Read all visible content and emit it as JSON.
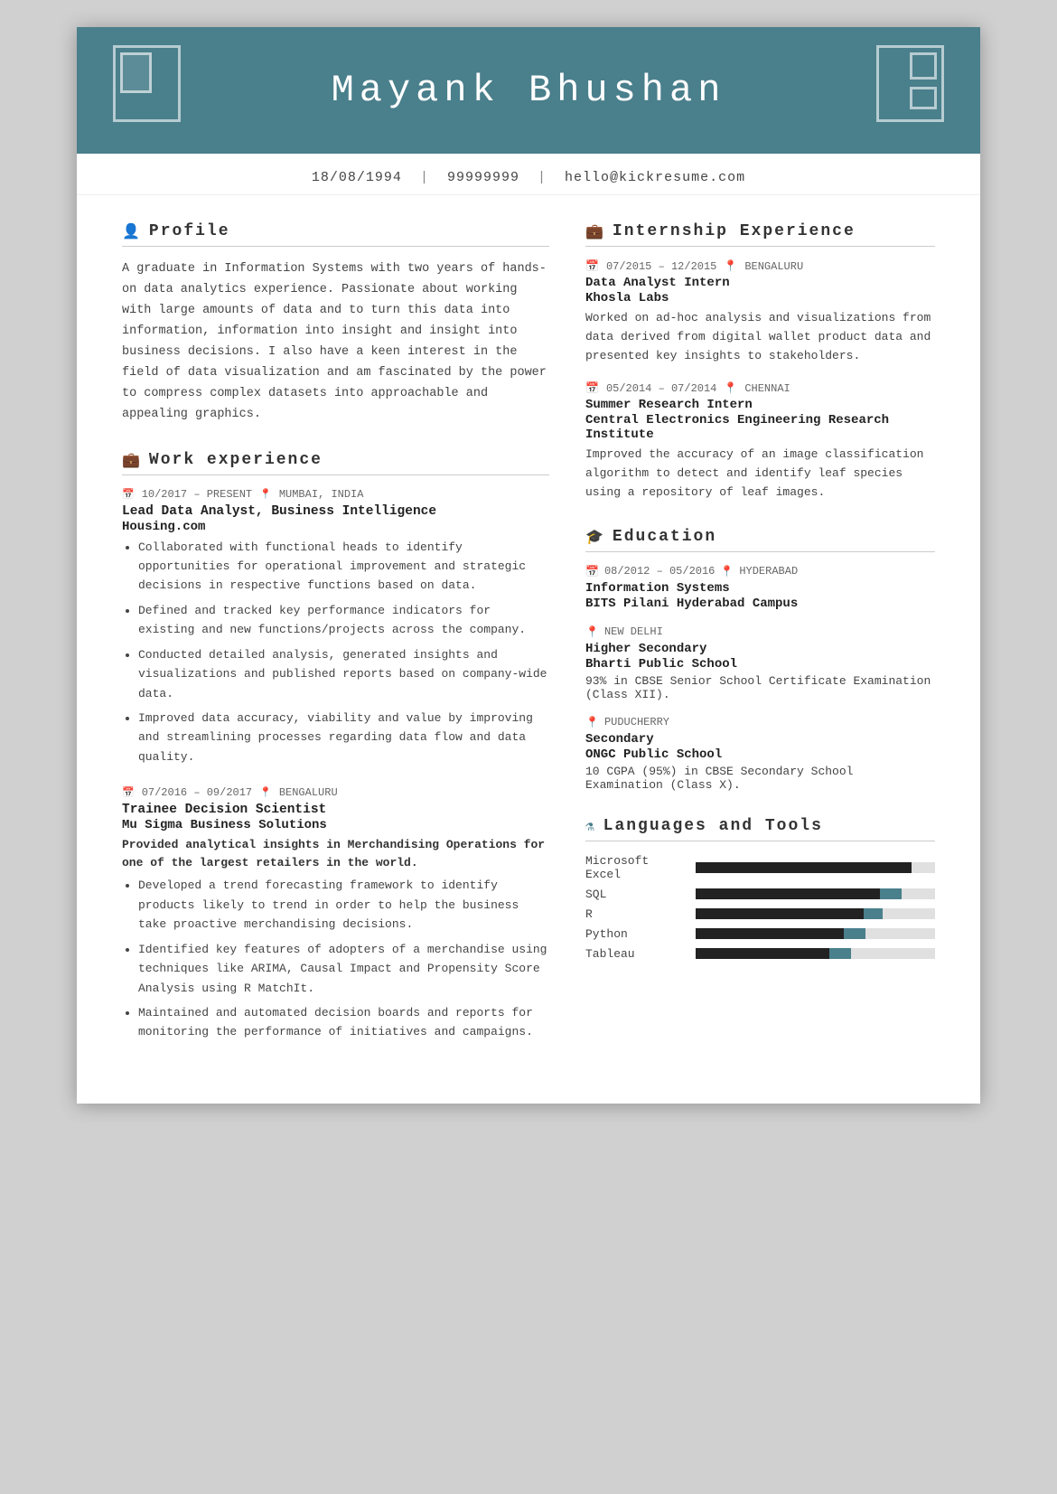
{
  "header": {
    "name": "Mayank  Bhushan"
  },
  "contact": {
    "dob": "18/08/1994",
    "phone": "99999999",
    "email": "hello@kickresume.com"
  },
  "profile": {
    "section_label": "Profile",
    "text": "A graduate in Information Systems with two years of hands-on data analytics experience. Passionate about working with large amounts of data and to turn this data into information, information into insight and insight into business decisions. I also have a keen interest in the field of data visualization and am fascinated by the power to compress complex datasets into approachable and appealing graphics."
  },
  "work_experience": {
    "section_label": "Work experience",
    "jobs": [
      {
        "date": "10/2017 – PRESENT",
        "location": "MUMBAI, INDIA",
        "title": "Lead Data Analyst, Business Intelligence",
        "company": "Housing.com",
        "bullets": [
          "Collaborated with functional heads to identify opportunities for operational improvement and strategic decisions in respective functions based on data.",
          "Defined and tracked key performance indicators for existing and new functions/projects across the company.",
          "Conducted detailed analysis, generated insights and visualizations and published reports based on company-wide data.",
          "Improved data accuracy, viability and value by improving and streamlining processes regarding data flow and data quality."
        ]
      },
      {
        "date": "07/2016 – 09/2017",
        "location": "BENGALURU",
        "title": "Trainee Decision Scientist",
        "company": "Mu Sigma Business Solutions",
        "desc_bold": "Provided analytical insights in Merchandising Operations for one of the largest retailers in the world.",
        "bullets": [
          "Developed a trend forecasting framework to identify products likely to trend in order to help the business take proactive merchandising decisions.",
          "Identified key features of adopters of a merchandise using techniques like ARIMA, Causal Impact and Propensity Score Analysis using R MatchIt.",
          "Maintained and automated decision boards and reports for monitoring the performance of initiatives and campaigns."
        ]
      }
    ]
  },
  "internship": {
    "section_label": "Internship Experience",
    "entries": [
      {
        "date": "07/2015 – 12/2015",
        "location": "BENGALURU",
        "title": "Data Analyst Intern",
        "org": "Khosla Labs",
        "desc": "Worked on ad-hoc analysis and visualizations from data derived from digital wallet product data and presented key insights to stakeholders."
      },
      {
        "date": "05/2014 – 07/2014",
        "location": "CHENNAI",
        "title": "Summer Research Intern",
        "org": "Central Electronics Engineering Research Institute",
        "desc": "Improved the accuracy of an image classification algorithm to detect and identify leaf species using a repository of leaf images."
      }
    ]
  },
  "education": {
    "section_label": "Education",
    "entries": [
      {
        "date": "08/2012 – 05/2016",
        "location": "HYDERABAD",
        "degree": "Information Systems",
        "school": "BITS Pilani Hyderabad Campus",
        "desc": ""
      },
      {
        "location": "NEW DELHI",
        "degree": "Higher Secondary",
        "school": "Bharti Public School",
        "desc": "93% in CBSE Senior School Certificate Examination (Class XII)."
      },
      {
        "location": "PUDUCHERRY",
        "degree": "Secondary",
        "school": "ONGC Public School",
        "desc": "10 CGPA (95%) in CBSE Secondary School Examination (Class X)."
      }
    ]
  },
  "skills": {
    "section_label": "Languages and Tools",
    "items": [
      {
        "name": "Microsoft Excel",
        "fill_pct": 90,
        "accent_start": 92,
        "accent_pct": 8
      },
      {
        "name": "SQL",
        "fill_pct": 75,
        "accent_start": 77,
        "accent_pct": 10
      },
      {
        "name": "R",
        "fill_pct": 68,
        "accent_start": 70,
        "accent_pct": 8
      },
      {
        "name": "Python",
        "fill_pct": 60,
        "accent_start": 62,
        "accent_pct": 8
      },
      {
        "name": "Tableau",
        "fill_pct": 55,
        "accent_start": 57,
        "accent_pct": 8
      }
    ]
  }
}
